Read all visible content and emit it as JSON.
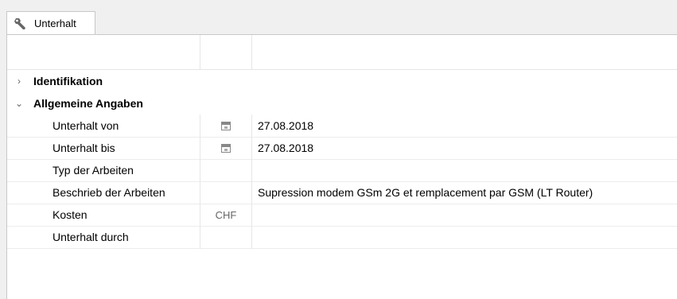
{
  "tab": {
    "label": "Unterhalt",
    "icon": "wrench-icon"
  },
  "groups": [
    {
      "label": "Identifikation",
      "expanded": false
    },
    {
      "label": "Allgemeine Angaben",
      "expanded": true
    }
  ],
  "properties": [
    {
      "label": "Unterhalt von",
      "unit": "",
      "icon": "calendar-icon",
      "value": "27.08.2018"
    },
    {
      "label": "Unterhalt bis",
      "unit": "",
      "icon": "calendar-icon",
      "value": "27.08.2018"
    },
    {
      "label": "Typ der Arbeiten",
      "unit": "",
      "icon": "",
      "value": ""
    },
    {
      "label": "Beschrieb der Arbeiten",
      "unit": "",
      "icon": "",
      "value": "Supression modem GSm 2G et remplacement par GSM (LT Router)"
    },
    {
      "label": "Kosten",
      "unit": "CHF",
      "icon": "",
      "value": ""
    },
    {
      "label": "Unterhalt durch",
      "unit": "",
      "icon": "",
      "value": ""
    }
  ]
}
